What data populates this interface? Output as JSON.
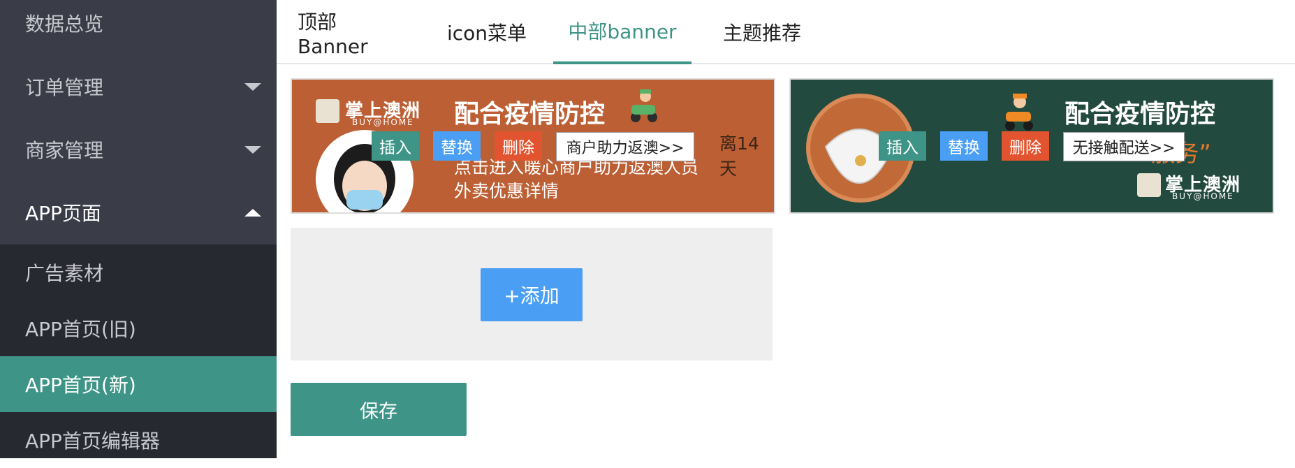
{
  "sidebar": {
    "items": [
      {
        "label": "数据总览"
      },
      {
        "label": "订单管理"
      },
      {
        "label": "商家管理"
      },
      {
        "label": "APP页面"
      }
    ],
    "subitems": [
      {
        "label": "广告素材"
      },
      {
        "label": "APP首页(旧)"
      },
      {
        "label": "APP首页(新)"
      },
      {
        "label": "APP首页编辑器"
      }
    ]
  },
  "tabs": [
    {
      "label": "顶部Banner"
    },
    {
      "label": "icon菜单"
    },
    {
      "label": "中部banner"
    },
    {
      "label": "主题推荐"
    }
  ],
  "banners": [
    {
      "logo": "掌上澳洲",
      "logo_sub": "BUY@HOME",
      "headline": "配合疫情防控",
      "line1": "点击进入暖心商户助力返澳人员",
      "line2": "外卖优惠详情",
      "tail": "离14天",
      "insert": "插入",
      "replace": "替换",
      "delete": "删除",
      "link": "商户助力返澳>>"
    },
    {
      "logo": "掌上澳洲",
      "logo_sub": "BUY@HOME",
      "headline": "配合疫情防控",
      "subline": "“ 服务”",
      "insert": "插入",
      "replace": "替换",
      "delete": "删除",
      "link": "无接触配送>>"
    }
  ],
  "actions": {
    "add": "+添加",
    "save": "保存"
  }
}
